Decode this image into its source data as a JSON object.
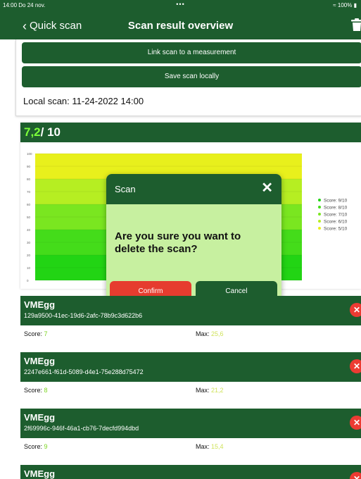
{
  "status": {
    "time": "14:00  Do 24 nov.",
    "dots": "•••",
    "battery": "100%"
  },
  "nav": {
    "back_label": "Quick scan",
    "title": "Scan result overview",
    "trash_icon": "trash-icon"
  },
  "actions": {
    "link_label": "Link scan to a measurement",
    "save_label": "Save scan locally"
  },
  "local_scan": "Local scan: 11-24-2022 14:00",
  "score": {
    "value": "7,2",
    "total": "/ 10"
  },
  "chart_data": {
    "type": "area",
    "title": "",
    "xlabel": "",
    "ylabel": "",
    "ylim": [
      0,
      100
    ],
    "y_ticks": [
      "0",
      "10",
      "20",
      "30",
      "40",
      "50",
      "60",
      "70",
      "80",
      "90",
      "100"
    ],
    "bands": [
      {
        "name": "Score: 9/10",
        "from": 0,
        "to": 20,
        "color": "#22d414"
      },
      {
        "name": "Score: 8/10",
        "from": 20,
        "to": 40,
        "color": "#44dc1a"
      },
      {
        "name": "Score: 7/10",
        "from": 40,
        "to": 60,
        "color": "#7ae620"
      },
      {
        "name": "Score: 6/10",
        "from": 60,
        "to": 80,
        "color": "#b6ee22"
      },
      {
        "name": "Score: 5/10",
        "from": 80,
        "to": 100,
        "color": "#e8f01c"
      }
    ],
    "legend_position": "right",
    "legend": [
      "Score: 9/10",
      "Score: 8/10",
      "Score: 7/10",
      "Score: 6/10",
      "Score: 5/10"
    ]
  },
  "modal": {
    "title": "Scan",
    "message": "Are you sure you want to delete the scan?",
    "confirm": "Confirm",
    "cancel": "Cancel"
  },
  "entries": [
    {
      "name": "VMEgg",
      "id": "129a9500-41ec-19d6-2afc-78b9c3d622b6",
      "score_label": "Score:",
      "score": "7",
      "max_label": "Max:",
      "max": "25,6"
    },
    {
      "name": "VMEgg",
      "id": "2247e661-f61d-5089-d4e1-75e288d75472",
      "score_label": "Score:",
      "score": "8",
      "max_label": "Max:",
      "max": "21,2"
    },
    {
      "name": "VMEgg",
      "id": "2f69996c-946f-46a1-cb76-7decfd994dbd",
      "score_label": "Score:",
      "score": "9",
      "max_label": "Max:",
      "max": "15,4"
    },
    {
      "name": "VMEgg"
    }
  ],
  "colors": {
    "primary": "#1d5d2e",
    "accent": "#7bff3a",
    "danger": "#e63c2f",
    "modal_bg": "#c7f0a0"
  }
}
